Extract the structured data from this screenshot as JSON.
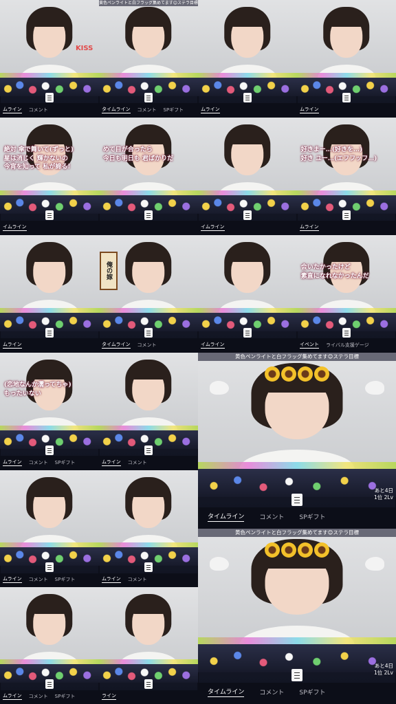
{
  "page": {
    "title": ""
  },
  "tiles": [
    {
      "id": "r1c1",
      "banner": "",
      "caption": [],
      "kiss": "KISS",
      "sign": "",
      "tabs": [
        "ムライン",
        "コメント"
      ],
      "active": 0
    },
    {
      "id": "r1c2",
      "banner": "黄色ペンライトと白フラッグ集めてます😊ステラ目標",
      "caption": [],
      "kiss": "",
      "sign": "",
      "tabs": [
        "タイムライン",
        "コメント",
        "SPギフト"
      ],
      "active": 0
    },
    {
      "id": "r1c3",
      "banner": "",
      "caption": [],
      "kiss": "",
      "sign": "",
      "tabs": [
        "ムライン"
      ],
      "active": 0
    },
    {
      "id": "r1c4",
      "banner": "",
      "caption": [],
      "kiss": "",
      "sign": "",
      "tabs": [
        "ムライン"
      ],
      "active": 0
    },
    {
      "id": "r2c1",
      "banner": "",
      "caption": [
        "絶対 傘で舞いて(ずっと)",
        "星は消じく 輝かないの",
        "今宵を知って 私が諦る!"
      ],
      "kiss": "",
      "sign": "",
      "tabs": [
        "イムライン"
      ],
      "active": 0
    },
    {
      "id": "r2c2",
      "banner": "",
      "caption": [
        "めて目が合ったら",
        "今日も明日も 君ばかりだ"
      ],
      "kiss": "",
      "sign": "",
      "tabs": [],
      "active": 0
    },
    {
      "id": "r2c3",
      "banner": "",
      "caption": [],
      "kiss": "",
      "sign": "",
      "tabs": [
        "イムライン"
      ],
      "active": 0
    },
    {
      "id": "r2c4",
      "banner": "",
      "caption": [
        "好きまー…(好きを…)",
        "好き ユー…(エフフッフ…)"
      ],
      "kiss": "",
      "sign": "",
      "tabs": [
        "ムライン"
      ],
      "active": 0
    },
    {
      "id": "r3c1",
      "banner": "",
      "caption": [],
      "kiss": "",
      "sign": "",
      "tabs": [
        "ムライン"
      ],
      "active": 0
    },
    {
      "id": "r3c2",
      "banner": "",
      "caption": [],
      "kiss": "",
      "sign": "俺の嫁",
      "tabs": [
        "タイムライン",
        "コメント"
      ],
      "active": 0
    },
    {
      "id": "r3c3",
      "banner": "",
      "caption": [],
      "kiss": "",
      "sign": "",
      "tabs": [
        "イムライン"
      ],
      "active": 0
    },
    {
      "id": "r3c4",
      "banner": "",
      "caption": [
        "会いたかったけど",
        "素直になれなかったんだ"
      ],
      "kiss": "",
      "sign": "",
      "tabs": [
        "イベント",
        "ライバル支援ゲージ"
      ],
      "active": 0
    },
    {
      "id": "r4c1",
      "banner": "",
      "caption": [
        "(恋地なんか濡ってちゃ)",
        "もったいない"
      ],
      "kiss": "",
      "sign": "",
      "tabs": [
        "ムライン",
        "コメント",
        "SPギフト"
      ],
      "active": 0
    },
    {
      "id": "r4c2",
      "banner": "",
      "caption": [],
      "kiss": "",
      "sign": "",
      "tabs": [
        "ムライン",
        "コメント"
      ],
      "active": 0
    },
    {
      "id": "r5c1",
      "banner": "",
      "caption": [],
      "kiss": "",
      "sign": "",
      "tabs": [
        "ムライン",
        "コメント",
        "SPギフト"
      ],
      "active": 0
    },
    {
      "id": "r5c2",
      "banner": "",
      "caption": [],
      "kiss": "",
      "sign": "",
      "tabs": [
        "ムライン",
        "コメント"
      ],
      "active": 0
    },
    {
      "id": "r6c1",
      "banner": "",
      "caption": [],
      "kiss": "",
      "sign": "",
      "tabs": [
        "ムライン",
        "コメント",
        "SPギフト"
      ],
      "active": 0
    },
    {
      "id": "r6c2",
      "banner": "",
      "caption": [],
      "kiss": "",
      "sign": "",
      "tabs": [
        "ライン"
      ],
      "active": 0
    }
  ],
  "big_tiles": [
    {
      "id": "big1",
      "banner": "黄色ペンライトと白フラッグ集めてます😊ステラ目標",
      "stats": [
        "あと4日",
        "1位 2Lv"
      ],
      "tabs": [
        "タイムライン",
        "コメント",
        "SPギフト"
      ],
      "active": 0
    },
    {
      "id": "big2",
      "banner": "黄色ペンライトと白フラッグ集めてます😊ステラ目標",
      "stats": [
        "あと4日",
        "1位 2Lv"
      ],
      "tabs": [
        "タイムライン",
        "コメント",
        "SPギフト"
      ],
      "active": 0
    }
  ]
}
